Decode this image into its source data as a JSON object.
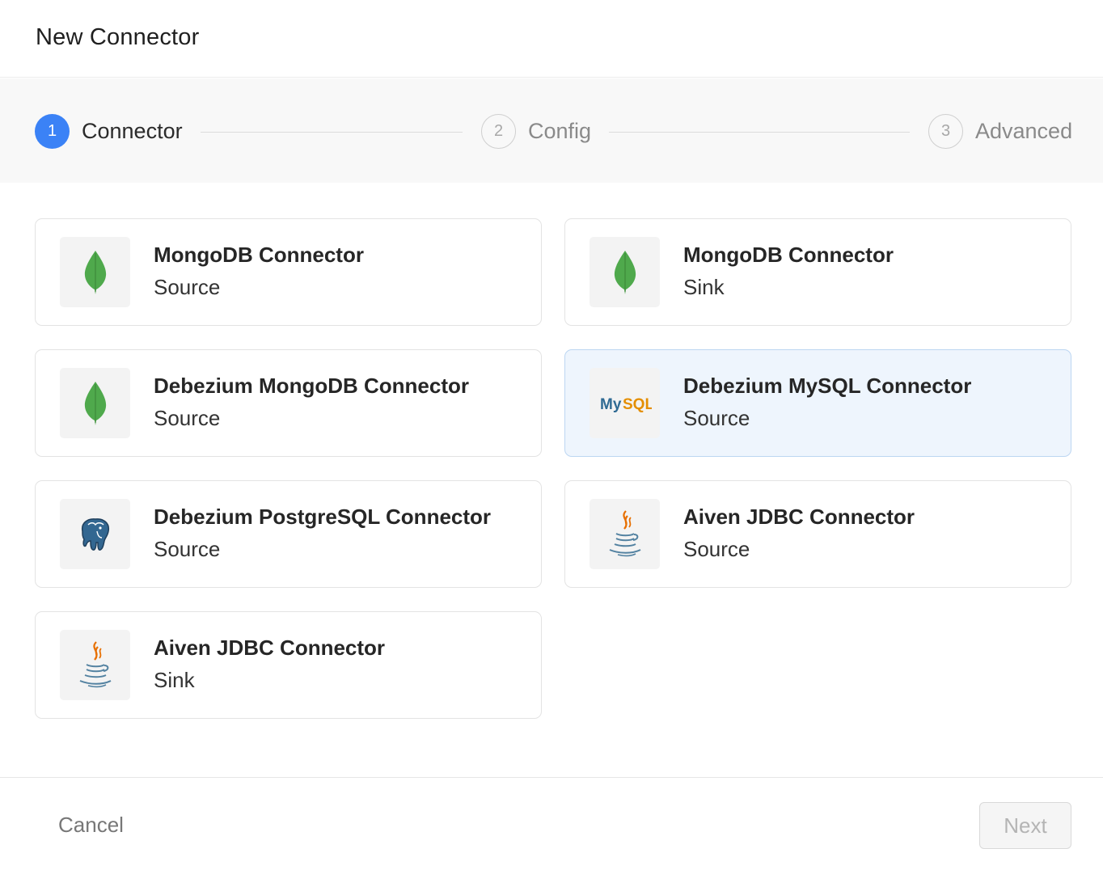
{
  "dialog": {
    "title": "New Connector"
  },
  "steps": [
    {
      "number": "1",
      "label": "Connector",
      "state": "active"
    },
    {
      "number": "2",
      "label": "Config",
      "state": "inactive"
    },
    {
      "number": "3",
      "label": "Advanced",
      "state": "inactive"
    }
  ],
  "connectors": [
    {
      "name": "MongoDB Connector",
      "kind": "Source",
      "icon": "mongodb-leaf-icon"
    },
    {
      "name": "MongoDB Connector",
      "kind": "Sink",
      "icon": "mongodb-leaf-icon"
    },
    {
      "name": "Debezium MongoDB Connector",
      "kind": "Source",
      "icon": "mongodb-leaf-icon"
    },
    {
      "name": "Debezium MySQL Connector",
      "kind": "Source",
      "icon": "mysql-logo-icon",
      "logo_text_my": "My",
      "logo_text_sql": "SQL",
      "selected": true
    },
    {
      "name": "Debezium PostgreSQL Connector",
      "kind": "Source",
      "icon": "postgresql-elephant-icon"
    },
    {
      "name": "Aiven JDBC Connector",
      "kind": "Source",
      "icon": "java-cup-icon"
    },
    {
      "name": "Aiven JDBC Connector",
      "kind": "Sink",
      "icon": "java-cup-icon"
    }
  ],
  "footer": {
    "cancel_label": "Cancel",
    "next_label": "Next"
  },
  "colors": {
    "accent": "#3b82f6",
    "selected_bg": "#eef5fd",
    "mongodb_green": "#4fa94c",
    "java_orange": "#e76f00",
    "java_blue": "#5382a1",
    "postgres_blue": "#336791"
  }
}
